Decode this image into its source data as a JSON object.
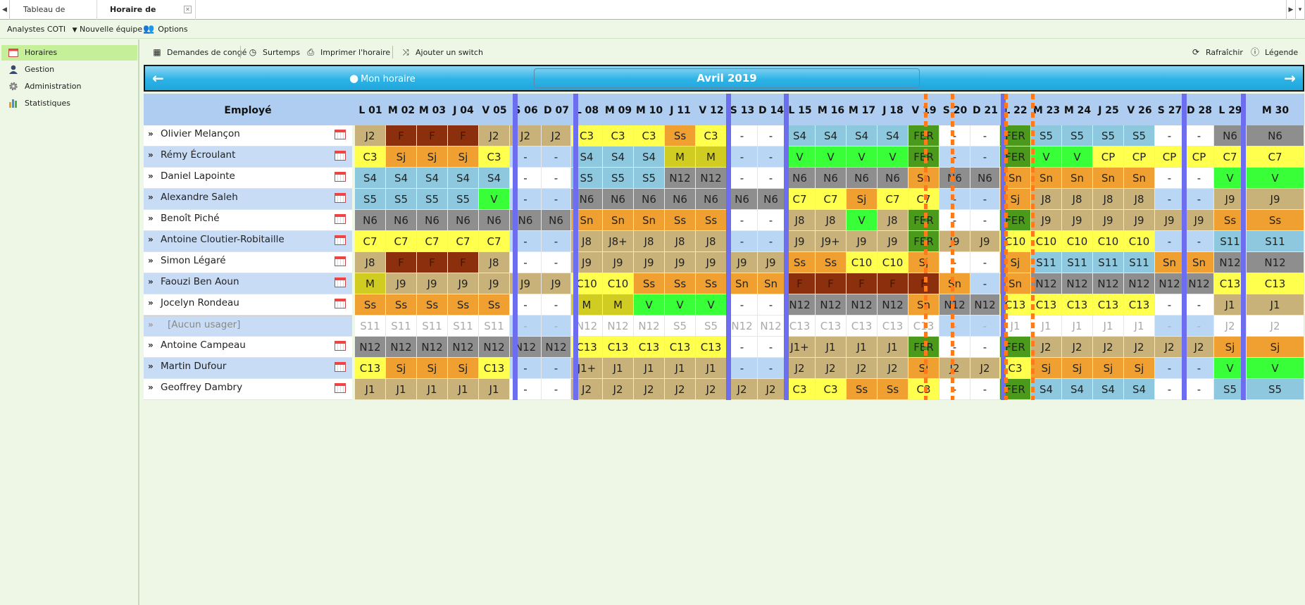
{
  "tabs": {
    "items": [
      "Tableau de bord",
      "Horaire de travail"
    ],
    "active": 1
  },
  "topbar": {
    "team": "Analystes COTI",
    "new_team": "Nouvelle équipe",
    "options": "Options"
  },
  "sidebar": {
    "items": [
      {
        "label": "Horaires",
        "icon": "calendar-icon"
      },
      {
        "label": "Gestion",
        "icon": "user-icon"
      },
      {
        "label": "Administration",
        "icon": "gear-icon"
      },
      {
        "label": "Statistiques",
        "icon": "bar-chart-icon"
      }
    ],
    "active": 0
  },
  "toolbar": {
    "leave": "Demandes de congé",
    "overtime": "Surtemps",
    "print": "Imprimer l'horaire",
    "switch": "Ajouter un switch",
    "refresh": "Rafraîchir",
    "legend": "Légende"
  },
  "nav": {
    "my_schedule": "Mon horaire",
    "month": "Avril 2019"
  },
  "employee_header": "Employé",
  "days": [
    "L 01",
    "M 02",
    "M 03",
    "J 04",
    "V 05",
    "S 06",
    "D 07",
    "L 08",
    "M 09",
    "M 10",
    "J 11",
    "V 12",
    "S 13",
    "D 14",
    "L 15",
    "M 16",
    "M 17",
    "J 18",
    "V 19",
    "S 20",
    "D 21",
    "L 22",
    "M 23",
    "M 24",
    "J 25",
    "V 26",
    "S 27",
    "D 28",
    "L 29",
    "M 30"
  ],
  "employees": [
    {
      "name": "Olivier Melançon",
      "shifts": [
        "J2",
        "F",
        "F",
        "F",
        "J2",
        "J2",
        "J2",
        "C3",
        "C3",
        "C3",
        "Ss",
        "C3",
        "-",
        "-",
        "S4",
        "S4",
        "S4",
        "S4",
        "FER",
        "-",
        "-",
        "FER",
        "S5",
        "S5",
        "S5",
        "S5",
        "-",
        "-",
        "N6",
        "N6"
      ]
    },
    {
      "name": "Rémy Écroulant",
      "shifts": [
        "C3",
        "Sj",
        "Sj",
        "Sj",
        "C3",
        "-",
        "-",
        "S4",
        "S4",
        "S4",
        "M",
        "M",
        "-",
        "-",
        "V",
        "V",
        "V",
        "V",
        "FER",
        "-",
        "-",
        "FER",
        "V",
        "V",
        "CP",
        "CP",
        "CP",
        "CP",
        "C7",
        "C7"
      ]
    },
    {
      "name": "Daniel Lapointe",
      "shifts": [
        "S4",
        "S4",
        "S4",
        "S4",
        "S4",
        "-",
        "-",
        "S5",
        "S5",
        "S5",
        "N12",
        "N12",
        "-",
        "-",
        "N6",
        "N6",
        "N6",
        "N6",
        "Sn",
        "N6",
        "N6",
        "Sn",
        "Sn",
        "Sn",
        "Sn",
        "Sn",
        "-",
        "-",
        "V",
        "V"
      ]
    },
    {
      "name": "Alexandre Saleh",
      "shifts": [
        "S5",
        "S5",
        "S5",
        "S5",
        "V",
        "-",
        "-",
        "N6",
        "N6",
        "N6",
        "N6",
        "N6",
        "N6",
        "N6",
        "C7",
        "C7",
        "Sj",
        "C7",
        "C7",
        "-",
        "-",
        "Sj",
        "J8",
        "J8",
        "J8",
        "J8",
        "-",
        "-",
        "J9",
        "J9"
      ]
    },
    {
      "name": "Benoît Piché",
      "shifts": [
        "N6",
        "N6",
        "N6",
        "N6",
        "N6",
        "N6",
        "N6",
        "Sn",
        "Sn",
        "Sn",
        "Ss",
        "Ss",
        "-",
        "-",
        "J8",
        "J8",
        "V",
        "J8",
        "FER",
        "-",
        "-",
        "FER",
        "J9",
        "J9",
        "J9",
        "J9",
        "J9",
        "J9",
        "Ss",
        "Ss"
      ]
    },
    {
      "name": "Antoine Cloutier-Robitaille",
      "shifts": [
        "C7",
        "C7",
        "C7",
        "C7",
        "C7",
        "-",
        "-",
        "J8",
        "J8+",
        "J8",
        "J8",
        "J8",
        "-",
        "-",
        "J9",
        "J9+",
        "J9",
        "J9",
        "FER",
        "J9",
        "J9",
        "C10",
        "C10",
        "C10",
        "C10",
        "C10",
        "-",
        "-",
        "S11",
        "S11"
      ]
    },
    {
      "name": "Simon Légaré",
      "shifts": [
        "J8",
        "F",
        "F",
        "F",
        "J8",
        "-",
        "-",
        "J9",
        "J9",
        "J9",
        "J9",
        "J9",
        "J9",
        "J9",
        "Ss",
        "Ss",
        "C10",
        "C10",
        "Sj",
        "-",
        "-",
        "Sj",
        "S11",
        "S11",
        "S11",
        "S11",
        "Sn",
        "Sn",
        "N12",
        "N12"
      ]
    },
    {
      "name": "Faouzi Ben Aoun",
      "shifts": [
        "M",
        "J9",
        "J9",
        "J9",
        "J9",
        "J9",
        "J9",
        "C10",
        "C10",
        "Ss",
        "Ss",
        "Ss",
        "Sn",
        "Sn",
        "F",
        "F",
        "F",
        "F",
        "F",
        "Sn",
        "-",
        "Sn",
        "N12",
        "N12",
        "N12",
        "N12",
        "N12",
        "N12",
        "C13",
        "C13"
      ]
    },
    {
      "name": "Jocelyn Rondeau",
      "shifts": [
        "Ss",
        "Ss",
        "Ss",
        "Ss",
        "Ss",
        "-",
        "-",
        "M",
        "M",
        "V",
        "V",
        "V",
        "-",
        "-",
        "N12",
        "N12",
        "N12",
        "N12",
        "Sn",
        "N12",
        "N12",
        "C13",
        "C13",
        "C13",
        "C13",
        "C13",
        "-",
        "-",
        "J1",
        "J1"
      ]
    },
    {
      "name": "[Aucun usager]",
      "shifts": [
        "S11",
        "S11",
        "S11",
        "S11",
        "S11",
        "-",
        "-",
        "N12",
        "N12",
        "N12",
        "S5",
        "S5",
        "N12",
        "N12",
        "C13",
        "C13",
        "C13",
        "C13",
        "C13",
        "-",
        "-",
        "J1",
        "J1",
        "J1",
        "J1",
        "J1",
        "-",
        "-",
        "J2",
        "J2"
      ]
    },
    {
      "name": "Antoine Campeau",
      "shifts": [
        "N12",
        "N12",
        "N12",
        "N12",
        "N12",
        "N12",
        "N12",
        "C13",
        "C13",
        "C13",
        "C13",
        "C13",
        "-",
        "-",
        "J1+",
        "J1",
        "J1",
        "J1",
        "FER",
        "-",
        "-",
        "FER",
        "J2",
        "J2",
        "J2",
        "J2",
        "J2",
        "J2",
        "Sj",
        "Sj"
      ]
    },
    {
      "name": "Martin Dufour",
      "shifts": [
        "C13",
        "Sj",
        "Sj",
        "Sj",
        "C13",
        "-",
        "-",
        "J1+",
        "J1",
        "J1",
        "J1",
        "J1",
        "-",
        "-",
        "J2",
        "J2",
        "J2",
        "J2",
        "Sj",
        "J2",
        "J2",
        "C3",
        "Sj",
        "Sj",
        "Sj",
        "Sj",
        "-",
        "-",
        "V",
        "V"
      ]
    },
    {
      "name": "Geoffrey Dambry",
      "shifts": [
        "J1",
        "J1",
        "J1",
        "J1",
        "J1",
        "-",
        "-",
        "J2",
        "J2",
        "J2",
        "J2",
        "J2",
        "J2",
        "J2",
        "C3",
        "C3",
        "Ss",
        "Ss",
        "C3",
        "-",
        "-",
        "FER",
        "S4",
        "S4",
        "S4",
        "S4",
        "-",
        "-",
        "S5",
        "S5"
      ]
    }
  ],
  "colors": {
    "J": "#c8b27a",
    "F": "#8c2f0d",
    "C": "#ffff4d",
    "Ss": "#f0a030",
    "Sj": "#f0a030",
    "Sn": "#f0a030",
    "S": "#8ec8de",
    "N": "#8e8e8e",
    "V": "#39ff39",
    "M": "#d0cc22",
    "CP": "#ffff4d",
    "FER": "#4c9a1c",
    "dash_odd": "#ffffff",
    "dash_even": "#b9d6f5",
    "unassigned": "#ffffff"
  }
}
